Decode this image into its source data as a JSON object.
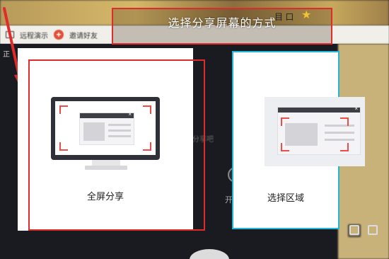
{
  "background": {
    "toolbar": {
      "remote_demo_label": "远程演示",
      "invite_friends_label": "邀请好友"
    },
    "left_glyph": "正",
    "middle_hint": "分享吧",
    "circle_label": "开",
    "title_area_glyphs": "目 口"
  },
  "banner": {
    "title": "选择分享屏幕的方式"
  },
  "options": {
    "full_screen": {
      "label": "全屏分享"
    },
    "select_region": {
      "label": "选择区域"
    }
  },
  "colors": {
    "annotation_red": "#e02b2b",
    "region_border": "#1fb8d8",
    "corner_red": "#ee4b4b"
  },
  "icons": {
    "star": "star-icon",
    "arrow": "annotation-arrow-icon",
    "monitor": "monitor-icon",
    "window_close": "close-icon"
  }
}
